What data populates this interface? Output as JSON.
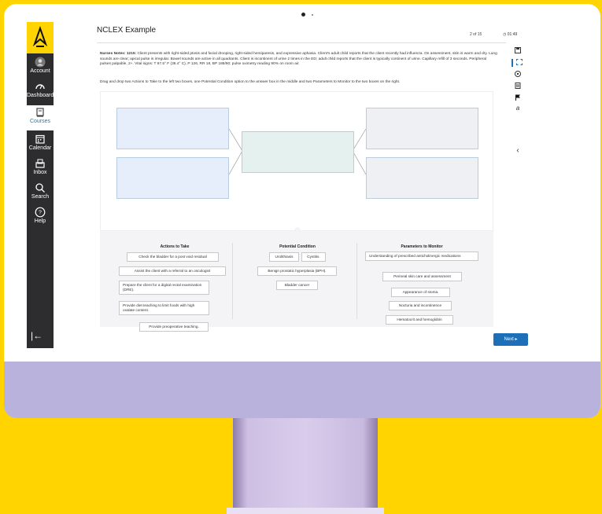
{
  "sidebar": {
    "items": [
      {
        "label": "Account"
      },
      {
        "label": "Dashboard"
      },
      {
        "label": "Courses"
      },
      {
        "label": "Calendar"
      },
      {
        "label": "Inbox"
      },
      {
        "label": "Search"
      },
      {
        "label": "Help"
      }
    ],
    "collapse_glyph": "|←"
  },
  "header": {
    "title": "NCLEX Example",
    "counter": "2 of 15",
    "timer": "01:49"
  },
  "question": {
    "notes_label": "Nurses Notes: 1215:",
    "notes_text": " Client presents with right-sided ptosis and facial drooping, right-sided hemiparesis, and expressive aphasia. Client's adult child reports that the client recently had influenza. On assessment, skin is warm and dry. Lung sounds are clear; apical pulse is irregular. Bowel sounds are active in all quadrants. Client is incontinent of urine 2 times in the ED; adult child reports that the client is typically continent of urine. Capillary refill of 3 seconds. Peripheral pulses palpable, 2+. Vital signs: T 97.5° F (36.4° C), P 126, RR 18, BP 188/90; pulse oximetry reading 90% on room air.",
    "instructions": "Drag and drop two Actions to Take to the left two boxes, one Potential Condition option to the answer box in the middle and two Parameters to Monitor to the two boxes on the right."
  },
  "columns": {
    "actions": {
      "title": "Actions to Take",
      "options": [
        "Check the bladder for a post void residual",
        "Assist the client with a referral to an oncologist",
        "Prepare the client for a digital rectal examination (DRE).",
        "Provide diet teaching to limit foods with high oxalate content.",
        "Provide preoperative teaching."
      ]
    },
    "condition": {
      "title": "Potential Condition",
      "options": [
        "Urolithiasis",
        "Cystitis.",
        "Benign prostatic hyperplasia (BPH).",
        "Bladder cancer"
      ]
    },
    "parameters": {
      "title": "Parameters to Monitor",
      "options": [
        "Understanding of prescribed anticholinergic medications",
        "Perineal skin care and assessment",
        "Appearance of stoma.",
        "Nocturia and incontinence",
        "Hematocrit and hemoglobin"
      ]
    }
  },
  "toolbar": {
    "icons": [
      "save-icon",
      "fullscreen-icon",
      "help-circle-icon",
      "calculator-icon",
      "flag-icon",
      "text-size-icon",
      "chevron-left-icon"
    ],
    "text_size_glyph": "a",
    "chevron_glyph": "‹"
  },
  "footer": {
    "next_label": "Next ▸"
  },
  "colors": {
    "background": "#ffd400",
    "sidebar": "#2d2d30",
    "accent": "#1d6fb8",
    "bezel": "#b9b2dd"
  }
}
